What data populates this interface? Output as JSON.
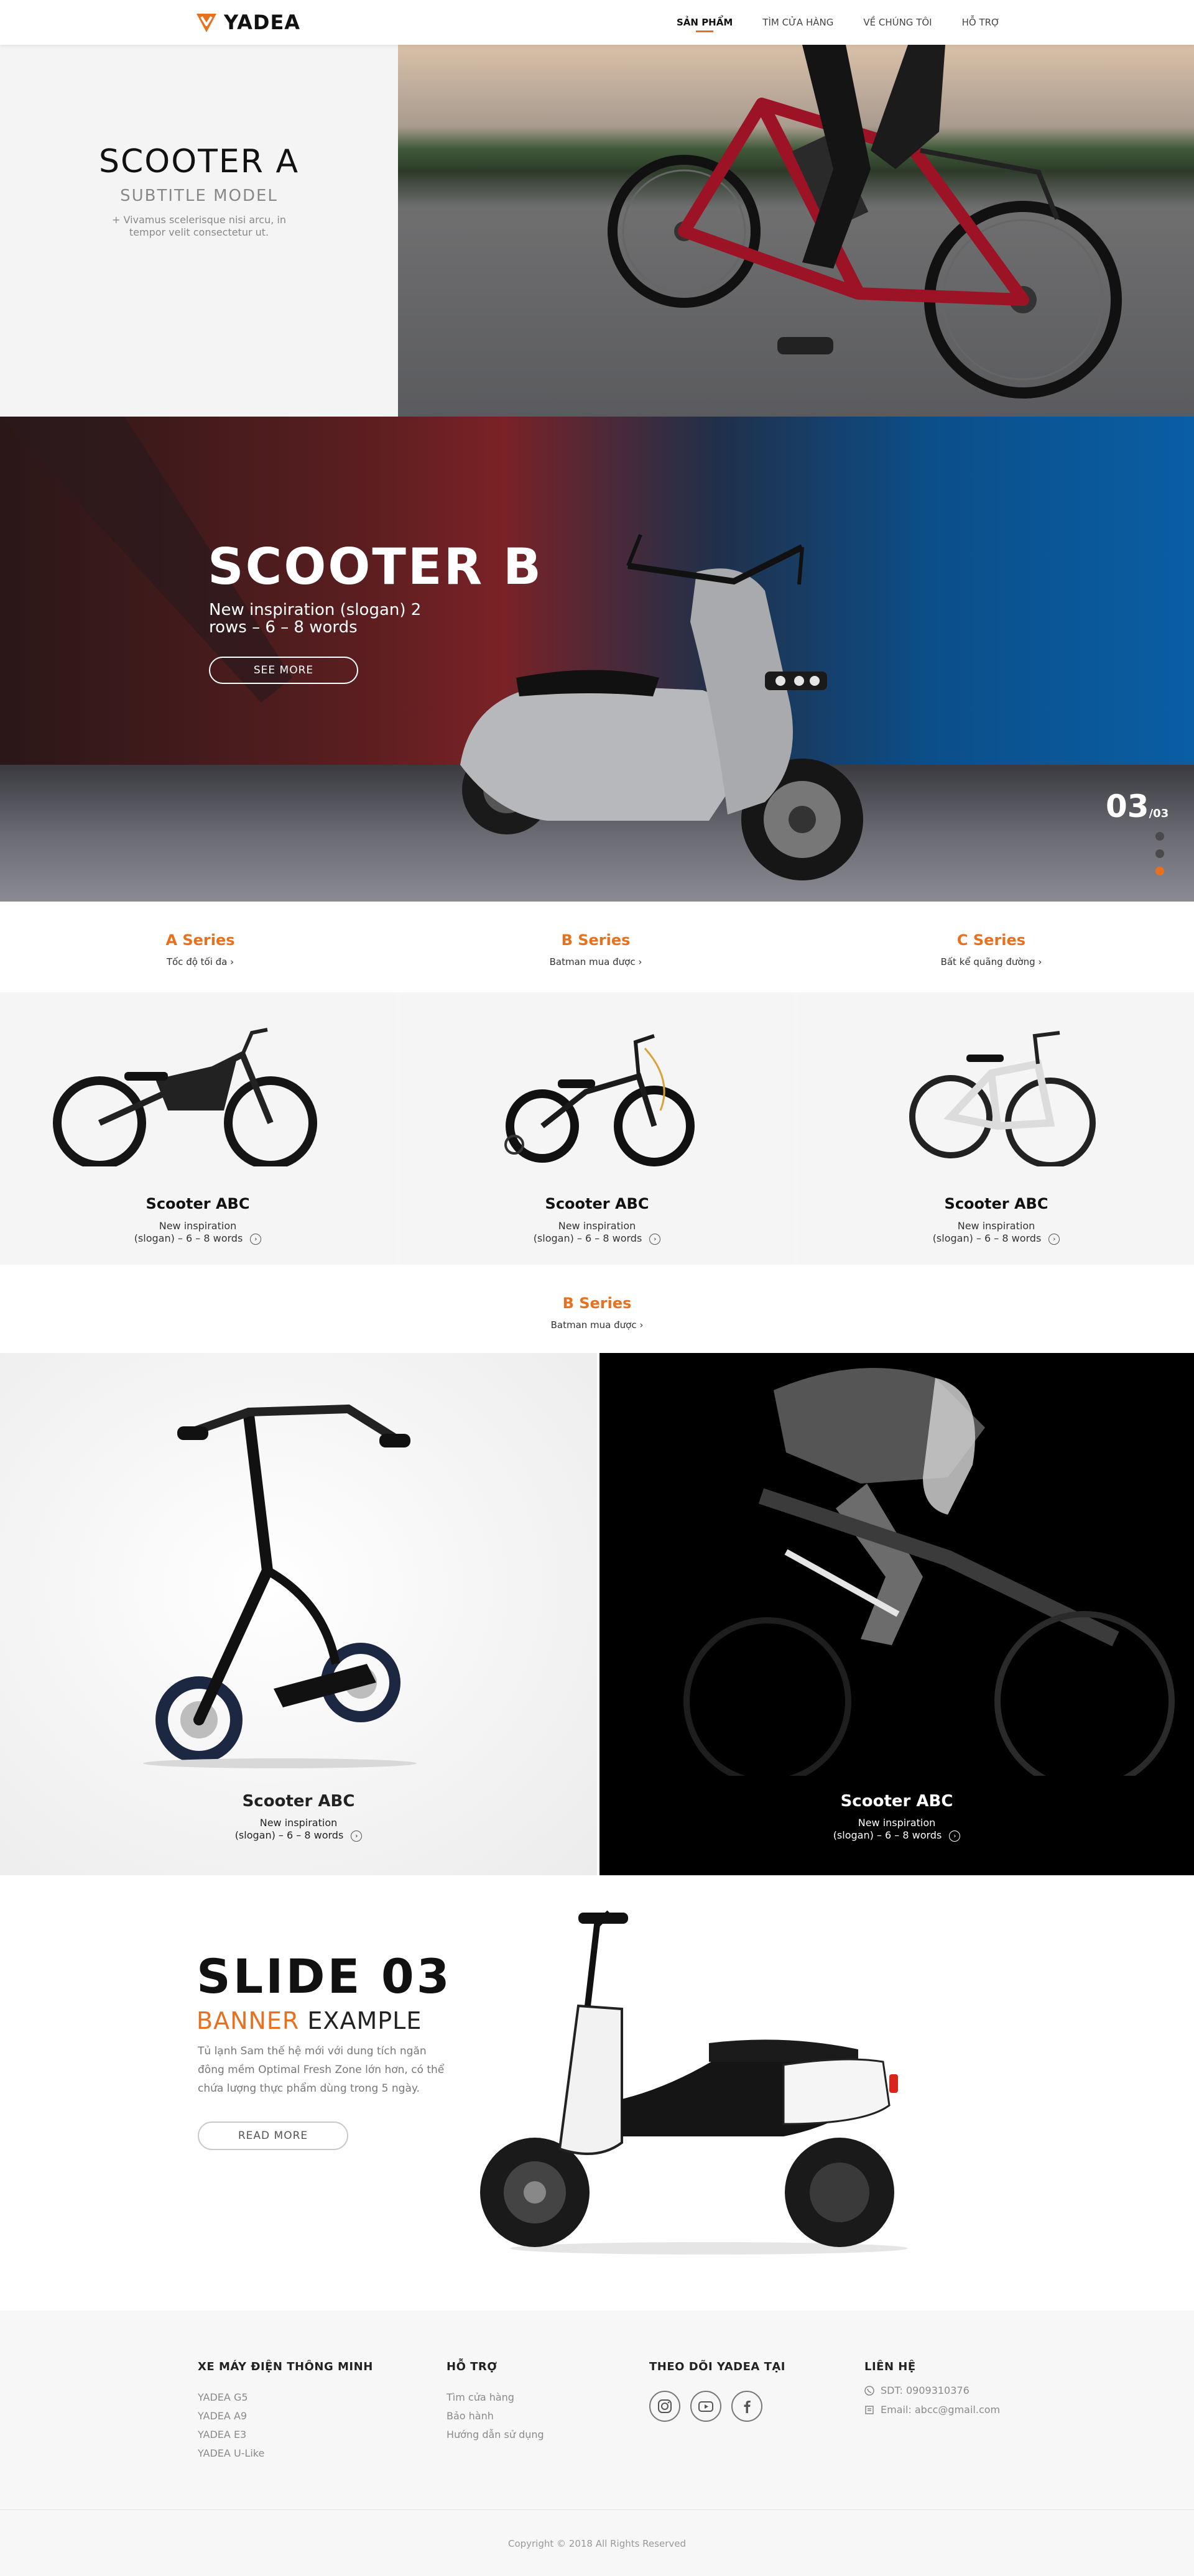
{
  "header": {
    "brand": "YADEA",
    "nav": [
      "SẢN PHẨM",
      "TÌM CỬA HÀNG",
      "VỀ CHÚNG TÔI",
      "HỖ TRỢ"
    ]
  },
  "hero_a": {
    "title": "SCOOTER A",
    "subtitle": "SUBTITLE MODEL",
    "desc": "+ Vivamus scelerisque nisi arcu, in tempor velit consectetur ut."
  },
  "hero_b": {
    "title": "SCOOTER B",
    "slogan": "New inspiration (slogan) 2 rows – 6 – 8 words",
    "button": "SEE MORE",
    "counter_current": "03",
    "counter_total": "/03",
    "active_dot": 3
  },
  "series_row": [
    {
      "title": "A Series",
      "link": "Tốc độ tối đa"
    },
    {
      "title": "B Series",
      "link": "Batman mua được"
    },
    {
      "title": "C Series",
      "link": "Bất kể quãng đường"
    }
  ],
  "cards": [
    {
      "name": "Scooter ABC",
      "slogan_line1": "New inspiration",
      "slogan_line2": "(slogan) – 6 – 8 words"
    },
    {
      "name": "Scooter ABC",
      "slogan_line1": "New inspiration",
      "slogan_line2": "(slogan) – 6 – 8 words"
    },
    {
      "name": "Scooter ABC",
      "slogan_line1": "New inspiration",
      "slogan_line2": "(slogan) – 6 – 8 words"
    }
  ],
  "series_b": {
    "title": "B Series",
    "link": "Batman mua được"
  },
  "big_cards": [
    {
      "name": "Scooter ABC",
      "slogan_line1": "New inspiration",
      "slogan_line2": "(slogan) – 6 – 8 words"
    },
    {
      "name": "Scooter ABC",
      "slogan_line1": "New inspiration",
      "slogan_line2": "(slogan) – 6 – 8 words"
    }
  ],
  "banner": {
    "title": "SLIDE 03",
    "sub_accent": "BANNER",
    "sub_rest": " EXAMPLE",
    "desc": "Tủ lạnh Sam thế hệ mới với dung tích ngăn đông mềm Optimal Fresh Zone lớn hơn, có thể chứa lượng thực phẩm dùng trong 5 ngày.",
    "button": "READ MORE"
  },
  "footer": {
    "col1": {
      "heading": "XE MÁY ĐIỆN THÔNG MINH",
      "links": [
        "YADEA G5",
        "YADEA A9",
        "YADEA E3",
        "YADEA U-Like"
      ]
    },
    "col2": {
      "heading": "HỖ TRỢ",
      "links": [
        "Tìm cửa hàng",
        "Bảo hành",
        "Hướng dẫn sử dụng"
      ]
    },
    "col3": {
      "heading": "THEO DÕI YADEA TẠI",
      "icons": [
        "instagram-icon",
        "youtube-icon",
        "facebook-icon"
      ]
    },
    "col4": {
      "heading": "LIÊN HỆ",
      "phone": "SDT: 0909310376",
      "email": "Email: abcc@gmail.com"
    },
    "copyright": "Copyright © 2018 All Rights Reserved"
  },
  "colors": {
    "accent": "#e8711f",
    "dark": "#111111",
    "footer_bg": "#f7f7f7"
  }
}
